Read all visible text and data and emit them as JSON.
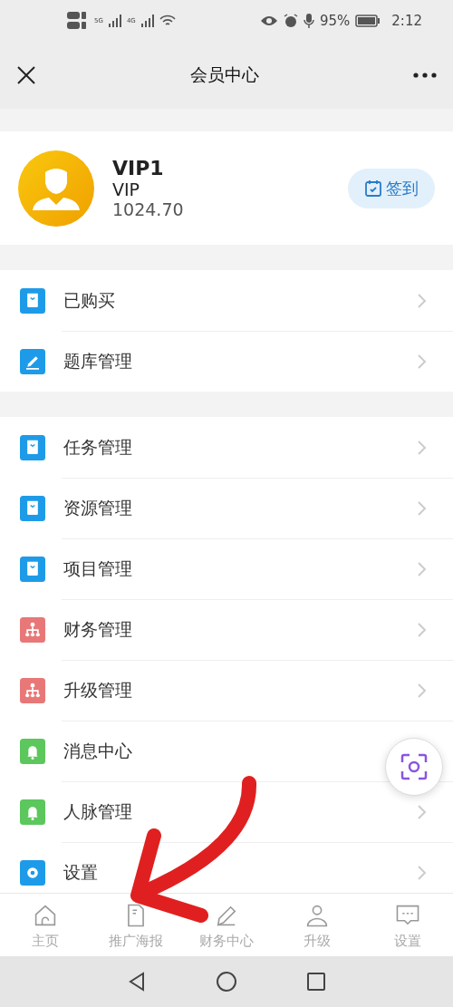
{
  "status_bar": {
    "network_1": "5G",
    "network_2": "4G",
    "battery": "95%",
    "time": "2:12"
  },
  "nav": {
    "title": "会员中心"
  },
  "profile": {
    "name": "VIP1",
    "level": "VIP",
    "balance": "1024.70",
    "checkin_button": "签到"
  },
  "groups": [
    {
      "items": [
        {
          "label": "已购买",
          "kind": "bag",
          "chevron": true
        },
        {
          "label": "题库管理",
          "kind": "pencil",
          "chevron": true
        }
      ]
    },
    {
      "items": [
        {
          "label": "任务管理",
          "kind": "bag",
          "chevron": true
        },
        {
          "label": "资源管理",
          "kind": "bag",
          "chevron": true
        },
        {
          "label": "项目管理",
          "kind": "bag",
          "chevron": true
        },
        {
          "label": "财务管理",
          "kind": "org",
          "chevron": true
        },
        {
          "label": "升级管理",
          "kind": "org",
          "chevron": true
        },
        {
          "label": "消息中心",
          "kind": "bell",
          "chevron": false
        },
        {
          "label": "人脉管理",
          "kind": "bell",
          "chevron": true
        },
        {
          "label": "设置",
          "kind": "gear",
          "chevron": true
        }
      ]
    }
  ],
  "tab_bar": [
    {
      "label": "主页",
      "kind": "home"
    },
    {
      "label": "推广海报",
      "kind": "doc"
    },
    {
      "label": "财务中心",
      "kind": "pen"
    },
    {
      "label": "升级",
      "kind": "user"
    },
    {
      "label": "设置",
      "kind": "chat"
    }
  ]
}
